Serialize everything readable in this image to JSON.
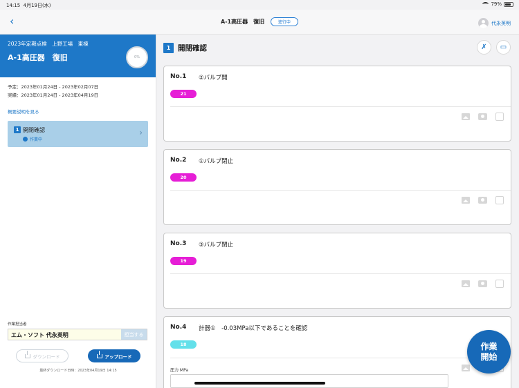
{
  "status_bar": {
    "time": "14:15",
    "date": "4月19日(水)",
    "battery": "79%",
    "battery_level": 0.79
  },
  "nav": {
    "back_label": "‹",
    "title": "A-1高圧器　復旧",
    "status_badge": "進行中",
    "user_name": "代永英明"
  },
  "sidebar": {
    "subtitle": "2023年定期点検　上野工場　東棟",
    "title": "A-1高圧器　復旧",
    "progress_label": "0%",
    "planned": "予定：2023年01月24日 - 2023年02月07日",
    "actual": "実績：2023年01月24日 - 2023年04月19日",
    "overview_link": "概要説明を見る",
    "step": {
      "number": "1",
      "name": "開閉確認",
      "status": "作業中"
    },
    "worker_label": "作業担当者",
    "worker_value": "エム・ソフト 代永英明",
    "assign_button": "担当する",
    "download_button": "ダウンロード",
    "upload_button": "アップロード",
    "last_download": "最終ダウンロード日時：2023年04月19日 14:15"
  },
  "main": {
    "section": {
      "number": "1",
      "title": "開閉確認"
    },
    "cards": [
      {
        "no": "No.1",
        "description": "②バルブ開",
        "badge": "21",
        "badge_color": "#e61ed6"
      },
      {
        "no": "No.2",
        "description": "①バルブ閉止",
        "badge": "20",
        "badge_color": "#e61ed6"
      },
      {
        "no": "No.3",
        "description": "③バルブ閉止",
        "badge": "19",
        "badge_color": "#e61ed6"
      },
      {
        "no": "No.4",
        "description": "計器①　-0.03MPa以下であることを確認",
        "badge": "18",
        "badge_color": "#63e0ea",
        "field_label": "圧力 MPa"
      }
    ]
  },
  "fab": {
    "line1": "作業",
    "line2": "開始"
  }
}
